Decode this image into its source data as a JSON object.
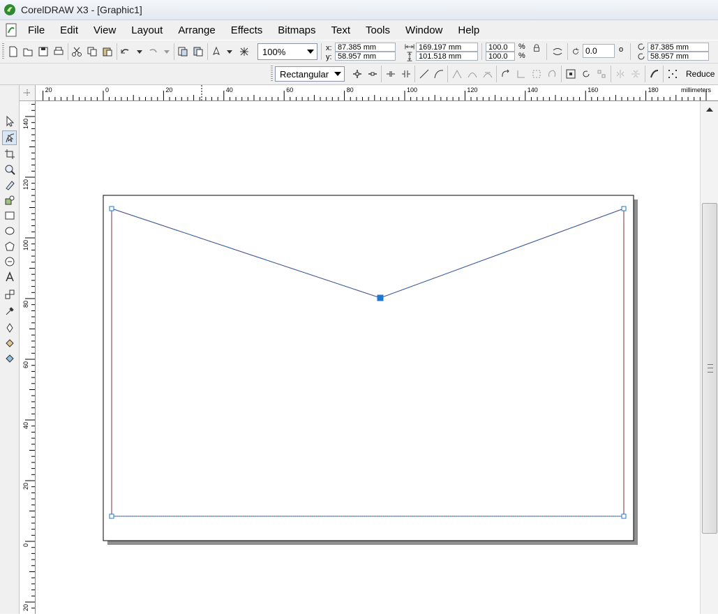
{
  "window": {
    "title": "CorelDRAW X3 - [Graphic1]"
  },
  "menu": [
    "File",
    "Edit",
    "View",
    "Layout",
    "Arrange",
    "Effects",
    "Bitmaps",
    "Text",
    "Tools",
    "Window",
    "Help"
  ],
  "toolbar": {
    "zoom": "100%",
    "pos_x_label": "x:",
    "pos_x": "87.385 mm",
    "pos_y_label": "y:",
    "pos_y": "58.957 mm",
    "width": "169.197 mm",
    "height": "101.518 mm",
    "scale_w": "100.0",
    "scale_h": "100.0",
    "pct": "%",
    "rotation": "0.0",
    "deg": "o",
    "center_x": "87.385 mm",
    "center_y": "58.957 mm"
  },
  "property_bar": {
    "curve_mode": "Rectangular",
    "reduce_label": "Reduce"
  },
  "ruler": {
    "units": "millimeters",
    "h_labels": [
      "20",
      "0",
      "20",
      "40",
      "60",
      "80",
      "100",
      "120",
      "140",
      "160",
      "180"
    ],
    "v_labels": [
      "140",
      "120",
      "100",
      "80",
      "60",
      "40",
      "20",
      "0",
      "20"
    ]
  },
  "colors": {
    "selection": "#1e78d2",
    "page_shadow": "#8f8f8f",
    "outline": "#7a2b3b"
  },
  "tools": [
    "pick-tool",
    "shape-tool",
    "crop-tool",
    "zoom-tool",
    "freehand-tool",
    "smart-fill-tool",
    "rectangle-tool",
    "ellipse-tool",
    "polygon-tool",
    "basic-shapes-tool",
    "text-tool",
    "interactive-blend-tool",
    "eyedropper-tool",
    "outline-tool",
    "fill-tool",
    "interactive-fill-tool"
  ]
}
